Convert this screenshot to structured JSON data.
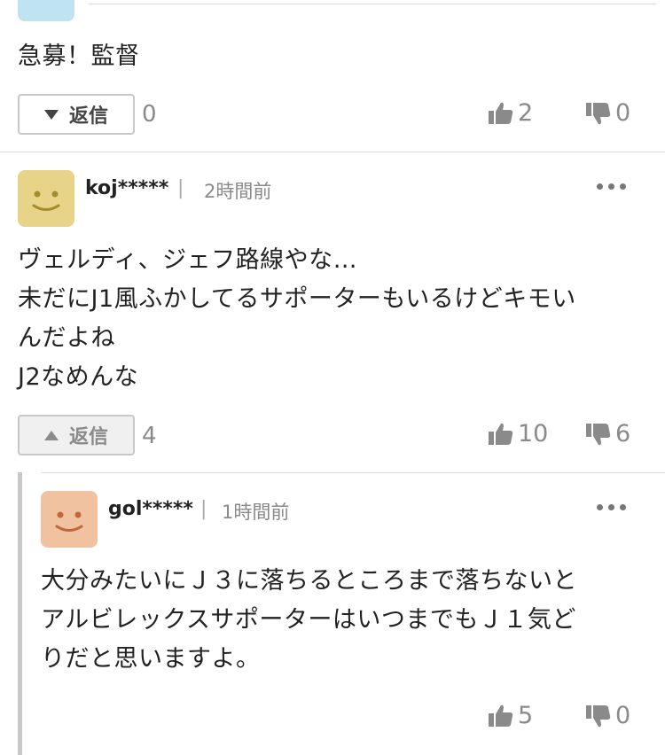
{
  "comment1": {
    "text": "急募！監督",
    "reply_label": "返信",
    "reply_count": "0",
    "likes": "2",
    "dislikes": "0"
  },
  "comment2": {
    "username": "koj*****",
    "separator": "|",
    "time": "2時間前",
    "lines": [
      "ヴェルディ、ジェフ路線やな…",
      "未だにJ1風ふかしてるサポーターもいるけどキモい",
      "んだよね",
      "J2なめんな"
    ],
    "reply_label": "返信",
    "reply_count": "4",
    "likes": "10",
    "dislikes": "6",
    "avatar_color": "#e8d488"
  },
  "reply1": {
    "username": "gol*****",
    "separator": "|",
    "time": "1時間前",
    "lines": [
      "大分みたいにＪ３に落ちるところまで落ちないと",
      "アルビレックスサポーターはいつまでもＪ１気ど",
      "りだと思いますよ。"
    ],
    "likes": "5",
    "dislikes": "0",
    "avatar_color": "#f0c2a0"
  }
}
